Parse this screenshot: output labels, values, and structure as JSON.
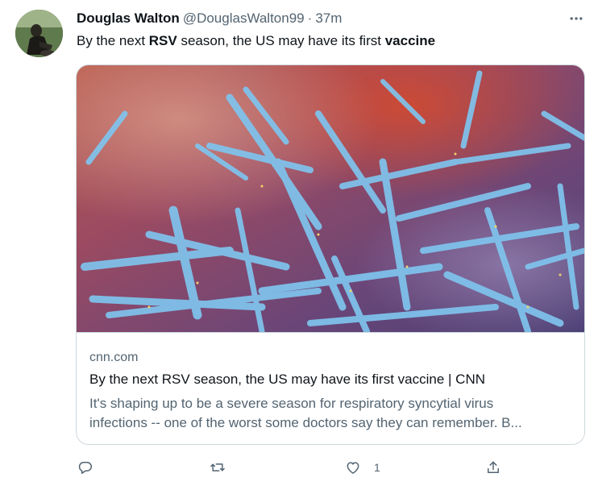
{
  "tweet": {
    "display_name": "Douglas Walton",
    "handle": "@DouglasWalton99",
    "separator": "·",
    "time": "37m",
    "text_parts": [
      "By the next ",
      "RSV",
      " season, the US may have its first ",
      "vaccine"
    ]
  },
  "card": {
    "domain": "cnn.com",
    "title": "By the next RSV season, the US may have its first vaccine | CNN",
    "description_line1": "It's shaping up to be a severe season for respiratory syncytial virus",
    "description_line2": "infections -- one of the worst some doctors say they can remember. B..."
  },
  "actions": {
    "reply_icon": "reply-icon",
    "retweet_icon": "retweet-icon",
    "like_icon": "heart-icon",
    "like_count": "1",
    "share_icon": "share-icon"
  },
  "colors": {
    "text_primary": "#0f1419",
    "text_secondary": "#536471",
    "border": "#cfd9de"
  }
}
